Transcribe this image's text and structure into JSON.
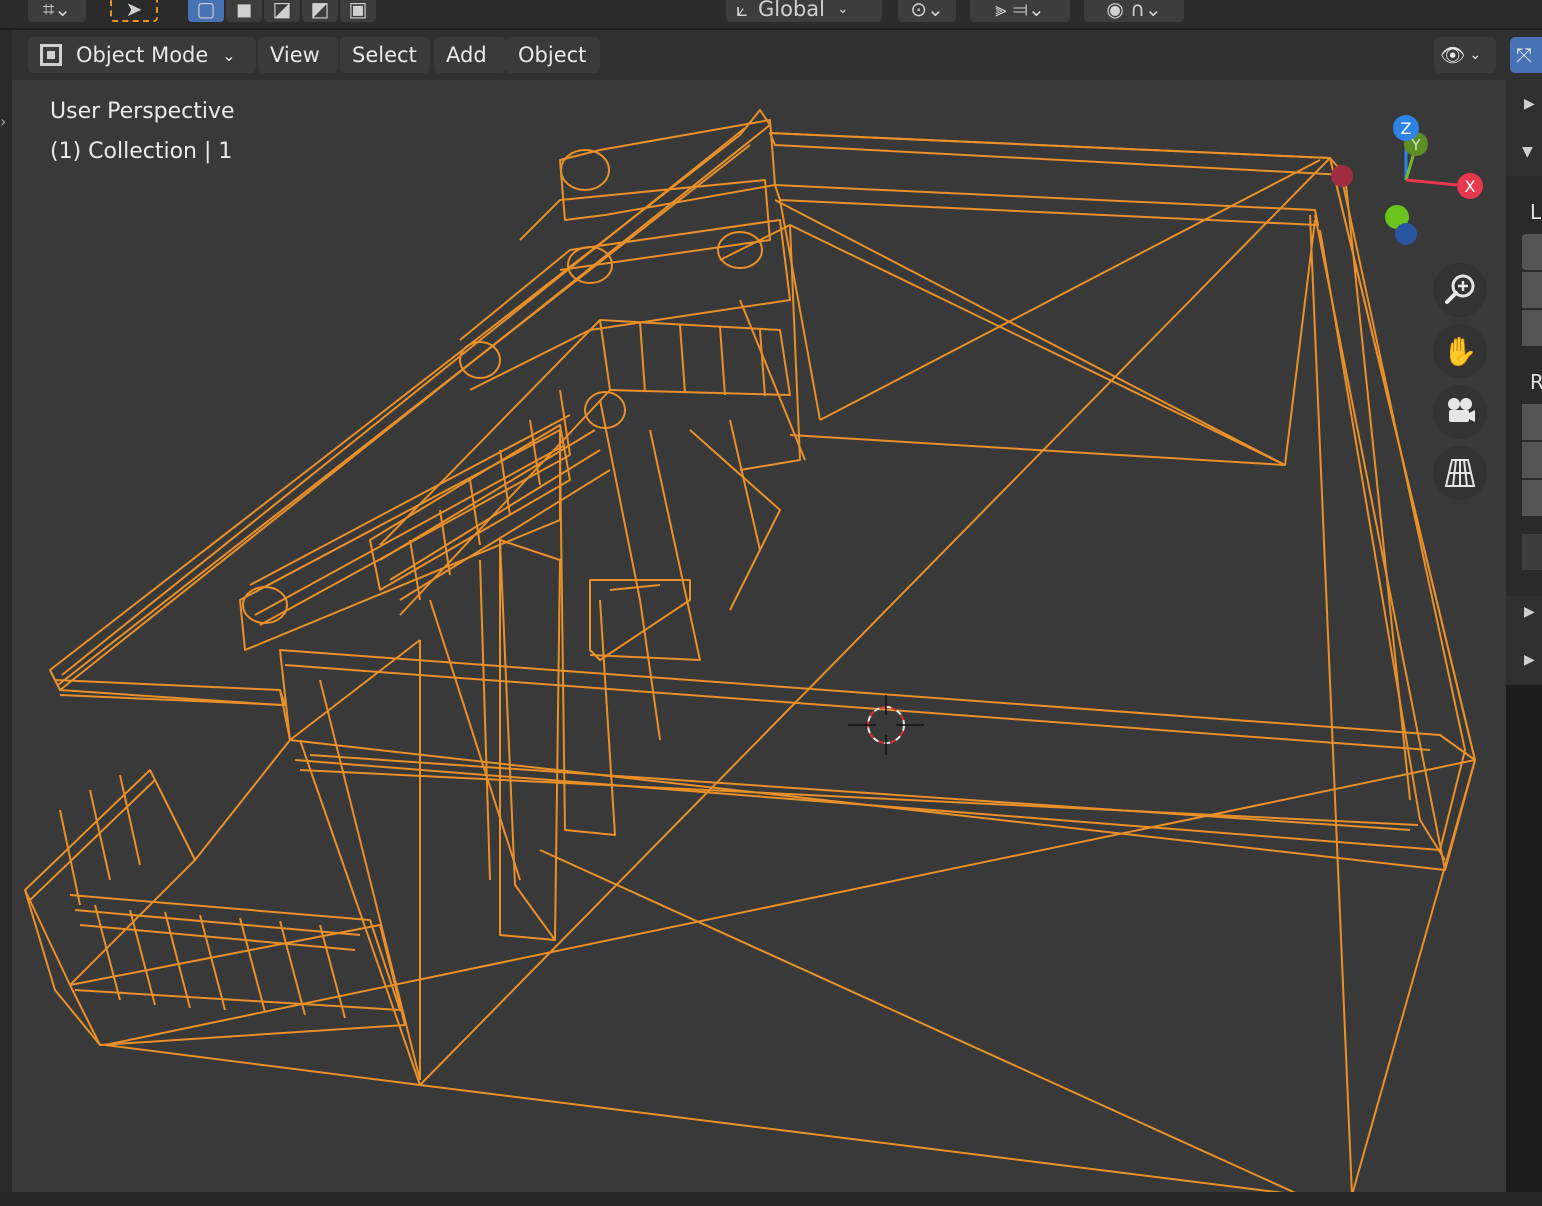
{
  "toolbar": {
    "transform_orientation": "Global"
  },
  "header": {
    "mode": "Object Mode",
    "menus": [
      "View",
      "Select",
      "Add",
      "Object"
    ]
  },
  "viewport": {
    "perspective_label": "User Perspective",
    "collection_label": "(1) Collection | 1",
    "wire_color": "#e8902a",
    "background": "#393939"
  },
  "gizmo": {
    "z": "Z",
    "y": "Y",
    "x": "X",
    "colors": {
      "x": "#e8384f",
      "y": "#7ab728",
      "z": "#2f83e6"
    }
  },
  "sidebar": {
    "letters": [
      "L",
      "R"
    ]
  },
  "icons": [
    "zoom-icon",
    "hand-pan-icon",
    "camera-icon",
    "grid-perspective-icon",
    "visibility-eye-icon",
    "editor-type-icon",
    "select-cursor-icon"
  ]
}
